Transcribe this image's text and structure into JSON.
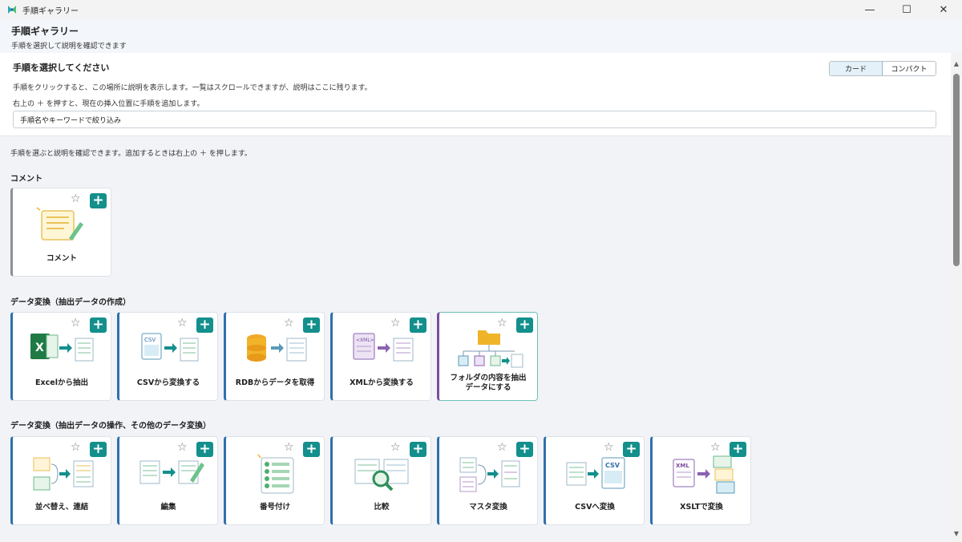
{
  "window": {
    "title": "手順ギャラリー"
  },
  "header": {
    "title": "手順ギャラリー",
    "subtitle": "手順を選択して説明を確認できます"
  },
  "description": {
    "title": "手順を選択してください",
    "line1": "手順をクリックすると、この場所に説明を表示します。一覧はスクロールできますが、説明はここに残ります。",
    "line2": "右上の ＋ を押すと、現在の挿入位置に手順を追加します。",
    "view_card": "カード",
    "view_compact": "コンパクト"
  },
  "filter": {
    "placeholder": "手順名やキーワードで絞り込み"
  },
  "hint": "手順を選ぶと説明を確認できます。追加するときは右上の ＋ を押します。",
  "icons": {
    "star": "☆",
    "plus": "+"
  },
  "sections": [
    {
      "title": "コメント",
      "cards": [
        {
          "label": "コメント",
          "icon": "comment-note-icon"
        }
      ]
    },
    {
      "title": "データ変換（抽出データの作成）",
      "cards": [
        {
          "label": "Excelから抽出",
          "icon": "excel-extract-icon"
        },
        {
          "label": "CSVから変換する",
          "icon": "csv-convert-icon"
        },
        {
          "label": "RDBからデータを取得",
          "icon": "database-fetch-icon"
        },
        {
          "label": "XMLから変換する",
          "icon": "xml-convert-icon"
        },
        {
          "label": "フォルダの内容を抽出データにする",
          "label_line1": "フォルダの内容を抽出",
          "label_line2": "データにする",
          "icon": "folder-tree-icon"
        }
      ]
    },
    {
      "title": "データ変換（抽出データの操作、その他のデータ変換）",
      "cards": [
        {
          "label": "並べ替え、連結",
          "icon": "sort-merge-icon"
        },
        {
          "label": "編集",
          "icon": "edit-table-icon"
        },
        {
          "label": "番号付け",
          "icon": "numbering-icon"
        },
        {
          "label": "比較",
          "icon": "compare-icon"
        },
        {
          "label": "マスタ変換",
          "icon": "master-convert-icon"
        },
        {
          "label": "CSVへ変換",
          "icon": "to-csv-icon"
        },
        {
          "label": "XSLTで変換",
          "icon": "xslt-convert-icon"
        }
      ]
    }
  ],
  "colors": {
    "accent": "#138f8c",
    "card_stripe": "#2f6fad",
    "comment_stripe": "#8d9096",
    "selected_stripe": "#7b4d9c"
  }
}
